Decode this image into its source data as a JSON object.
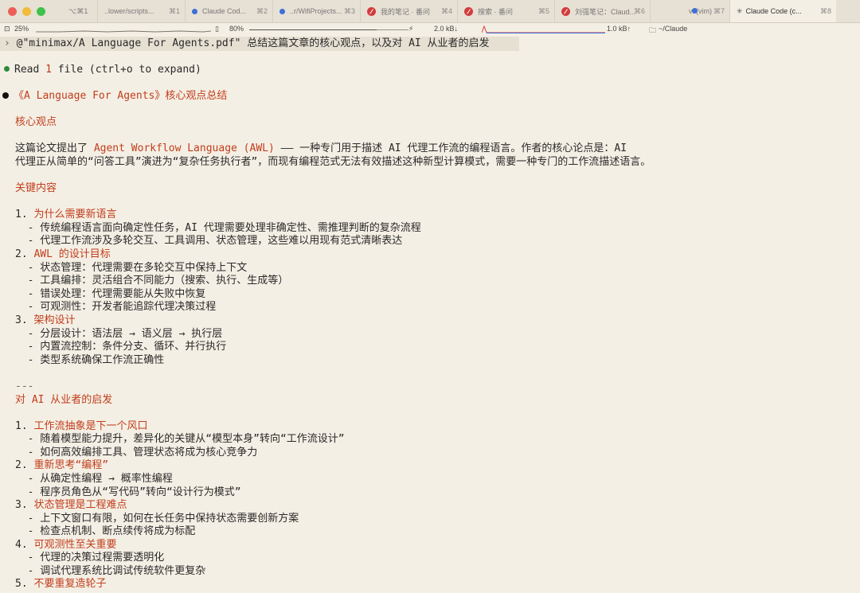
{
  "tabs": [
    {
      "label": "⌥⌘1",
      "short": ""
    },
    {
      "label": "..lower/scripts...",
      "short": "⌘1"
    },
    {
      "label": "Claude Cod...",
      "short": "⌘2"
    },
    {
      "label": "..r/WifiProjects...",
      "short": "⌘3"
    },
    {
      "label": "我的笔记 · 番问",
      "short": "⌘4"
    },
    {
      "label": "搜索 · 番问",
      "short": "⌘5"
    },
    {
      "label": "刘强笔记：Claud...",
      "short": "⌘6"
    },
    {
      "label": "vi (vim)",
      "short": "⌘7"
    },
    {
      "label": "Claude Code (c...",
      "short": "⌘8"
    }
  ],
  "status": {
    "cpu": "25%",
    "mem": "80%",
    "net_down": "2.0 kB↓",
    "net_up": "1.0 kB↑",
    "path": "~/Claude",
    "battery_fraction": 0.8
  },
  "terminal": {
    "prompt_symbol": "›",
    "prompt": "@\"minimax/A Language For Agents.pdf\" 总结这篇文章的核心观点，以及对 AI 从业者的启发",
    "read_prefix": "Read ",
    "read_count": "1",
    "read_suffix": " file (ctrl+o to expand)",
    "title": "《A Language For Agents》核心观点总结",
    "sec1": "核心观点",
    "intro_a": "这篇论文提出了 ",
    "intro_hl": "Agent Workflow Language (AWL)",
    "intro_b": " —— 一种专门用于描述 AI 代理工作流的编程语言。作者的核心论点是：AI",
    "intro_c": "代理正从简单的“问答工具”演进为“复杂任务执行者”，而现有编程范式无法有效描述这种新型计算模式，需要一种专门的工作流描述语言。",
    "sec2": "关键内容",
    "k1_num": "1. ",
    "k1": "为什么需要新语言",
    "k1a": "  - 传统编程语言面向确定性任务，AI 代理需要处理非确定性、需推理判断的复杂流程",
    "k1b": "  - 代理工作流涉及多轮交互、工具调用、状态管理，这些难以用现有范式清晰表达",
    "k2_num": "2. ",
    "k2": "AWL 的设计目标",
    "k2a": "  - 状态管理：代理需要在多轮交互中保持上下文",
    "k2b": "  - 工具编排：灵活组合不同能力（搜索、执行、生成等）",
    "k2c": "  - 错误处理：代理需要能从失败中恢复",
    "k2d": "  - 可观测性：开发者能追踪代理决策过程",
    "k3_num": "3. ",
    "k3": "架构设计",
    "k3a": "  - 分层设计：语法层 → 语义层 → 执行层",
    "k3b": "  - 内置流控制：条件分支、循环、并行执行",
    "k3c": "  - 类型系统确保工作流正确性",
    "sep": "---",
    "sec3": "对 AI 从业者的启发",
    "p1_num": "1. ",
    "p1": "工作流抽象是下一个风口",
    "p1a": "  - 随着模型能力提升，差异化的关键从“模型本身”转向“工作流设计”",
    "p1b": "  - 如何高效编排工具、管理状态将成为核心竞争力",
    "p2_num": "2. ",
    "p2": "重新思考“编程”",
    "p2a": "  - 从确定性编程 → 概率性编程",
    "p2b": "  - 程序员角色从“写代码”转向“设计行为模式”",
    "p3_num": "3. ",
    "p3": "状态管理是工程难点",
    "p3a": "  - 上下文窗口有限，如何在长任务中保持状态需要创新方案",
    "p3b": "  - 检查点机制、断点续传将成为标配",
    "p4_num": "4. ",
    "p4": "可观测性至关重要",
    "p4a": "  - 代理的决策过程需要透明化",
    "p4b": "  - 调试代理系统比调试传统软件更复杂",
    "p5_num": "5. ",
    "p5": "不要重复造轮子"
  },
  "colors": {
    "accent": "#c13d1d",
    "dot_green": "#2e8b3e",
    "tab_blue": "#3d6fd9",
    "tab_red": "#d33c3c"
  }
}
